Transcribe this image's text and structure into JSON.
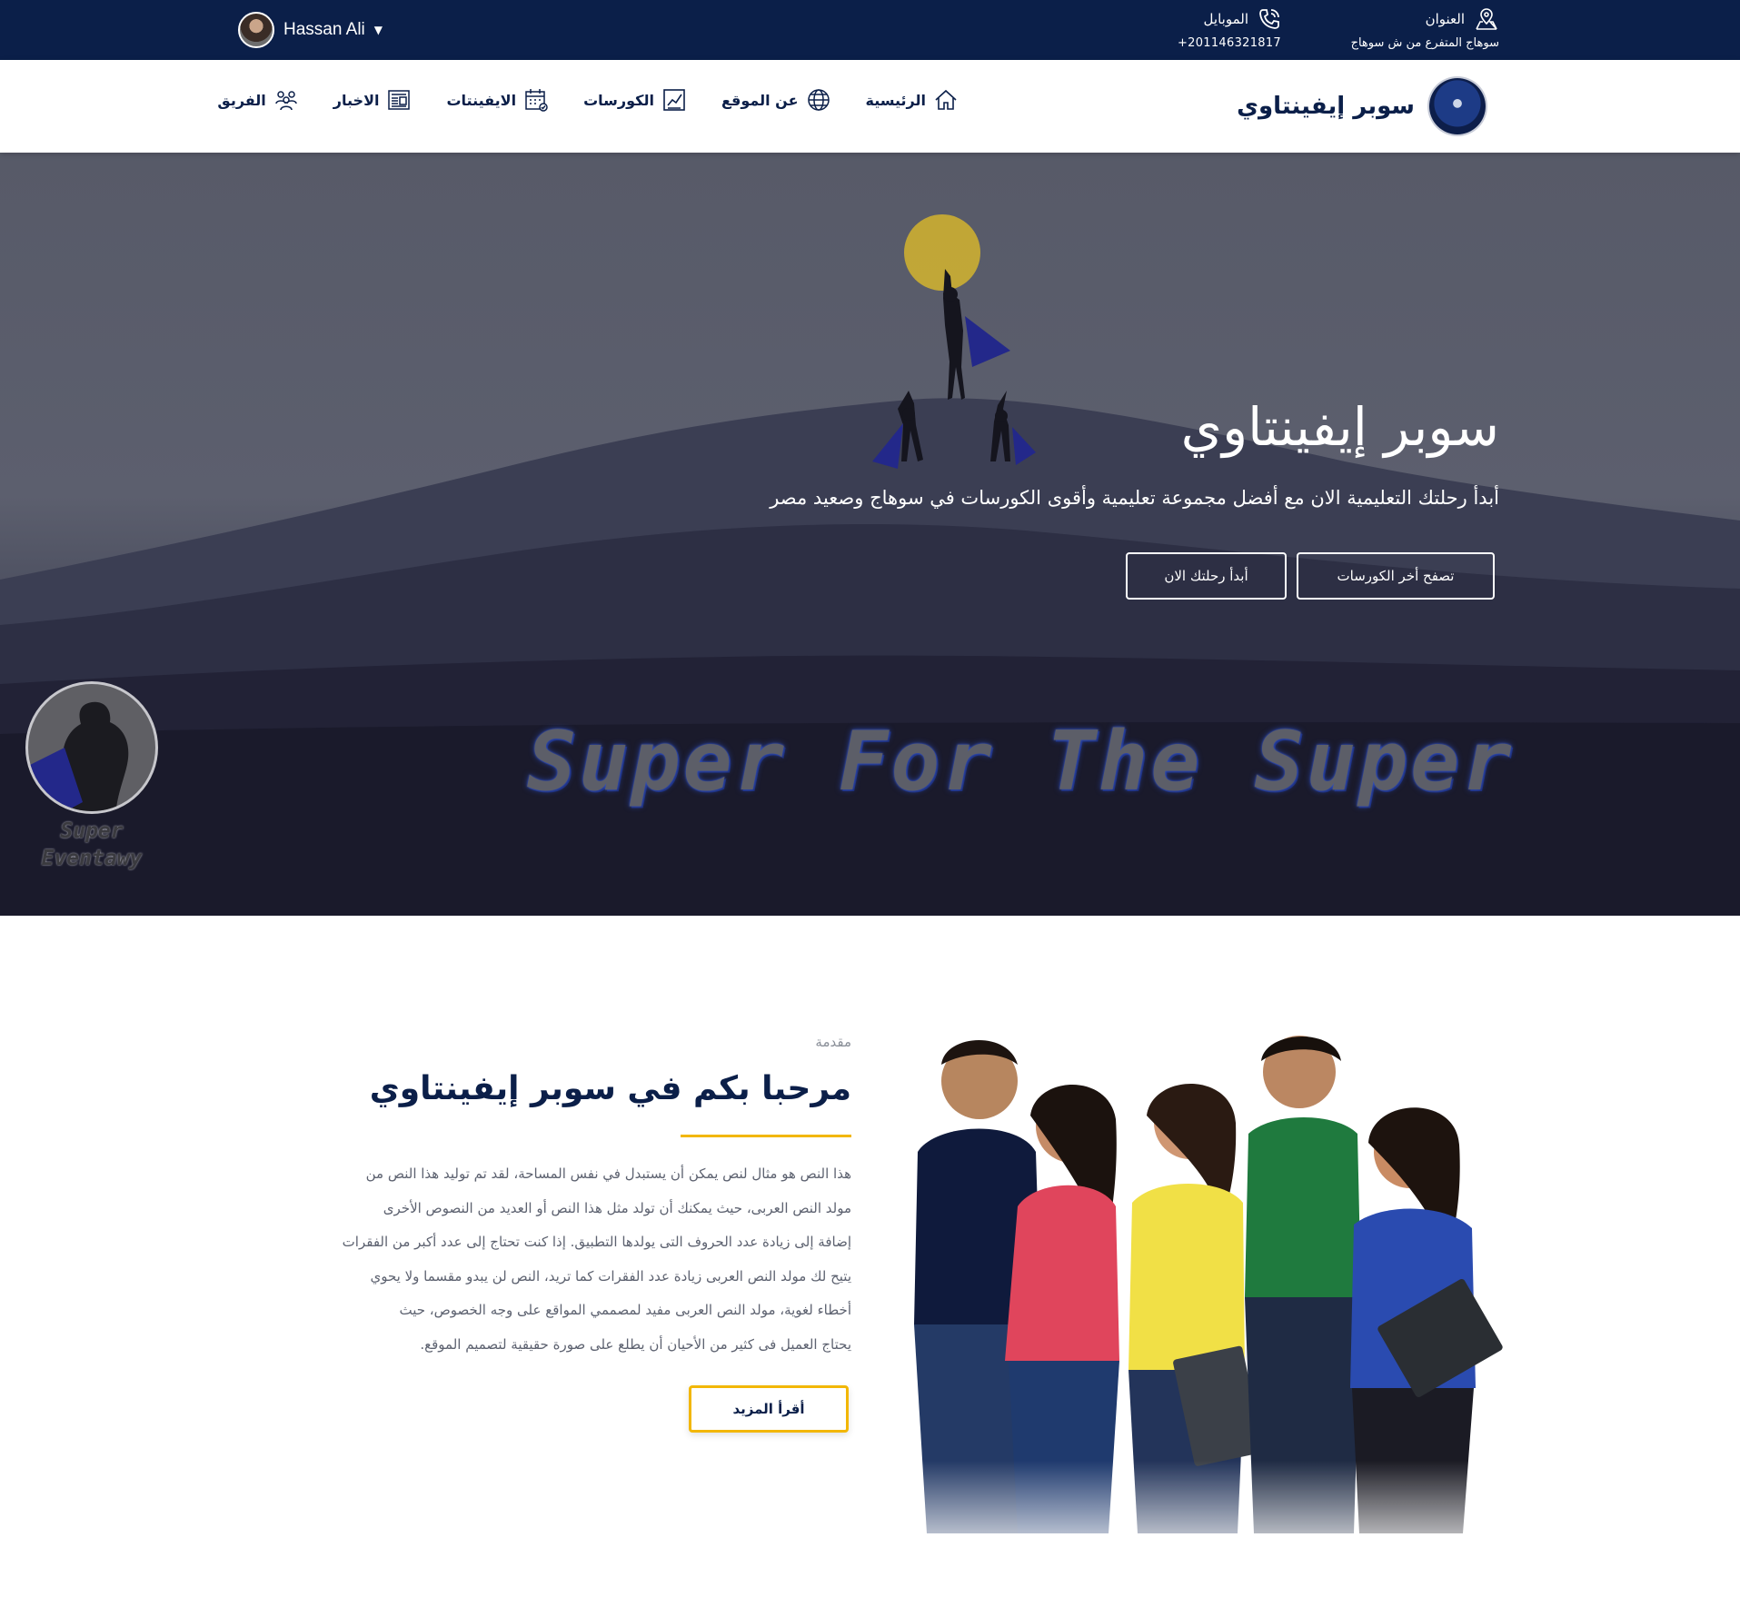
{
  "topbar": {
    "user_name": "Hassan Ali",
    "address_label": "العنوان",
    "address_value": "سوهاج المتفرع من ش سوهاج",
    "mobile_label": "الموبايل",
    "mobile_value": "+201146321817"
  },
  "brand": {
    "name": "سوبر إيفينتاوي"
  },
  "nav": {
    "items": [
      {
        "label": "الرئيسية",
        "icon": "home-icon"
      },
      {
        "label": "عن الموقع",
        "icon": "globe-icon"
      },
      {
        "label": "الكورسات",
        "icon": "chart-board-icon"
      },
      {
        "label": "الايفينتات",
        "icon": "calendar-icon"
      },
      {
        "label": "الاخبار",
        "icon": "newspaper-icon"
      },
      {
        "label": "الفريق",
        "icon": "team-icon"
      }
    ]
  },
  "hero": {
    "title": "سوبر إيفينتاوي",
    "subtitle": "أبدأ رحلتك التعليمية الان مع أفضل مجموعة تعليمية وأقوى الكورسات في سوهاج وصعيد مصر",
    "browse_button": "تصفح أخر الكورسات",
    "start_button": "أبدأ رحلتك الان",
    "slogan": "Super For The Super",
    "watermark_line1": "Super",
    "watermark_line2": "Eventawy"
  },
  "intro": {
    "eyebrow": "مقدمة",
    "heading": "مرحبا بكم في سوبر إيفينتاوي",
    "paragraph_lines": [
      "هذا النص هو مثال لنص يمكن أن يستبدل في نفس المساحة، لقد تم توليد هذا النص من",
      "مولد النص العربى، حيث يمكنك أن تولد مثل هذا النص أو العديد من النصوص الأخرى",
      "إضافة إلى زيادة عدد الحروف التى يولدها التطبيق. إذا كنت تحتاج إلى عدد أكبر من الفقرات",
      "يتيح لك مولد النص العربى زيادة عدد الفقرات كما تريد، النص لن يبدو مقسما ولا يحوي",
      "أخطاء لغوية، مولد النص العربى مفيد لمصممي المواقع على وجه الخصوص، حيث",
      "يحتاج العميل فى كثير من الأحيان أن يطلع على صورة حقيقية لتصميم الموقع."
    ],
    "read_more": "أقرأ المزيد"
  },
  "colors": {
    "navy": "#0b1f49",
    "gold": "#f2b705",
    "white": "#ffffff"
  }
}
